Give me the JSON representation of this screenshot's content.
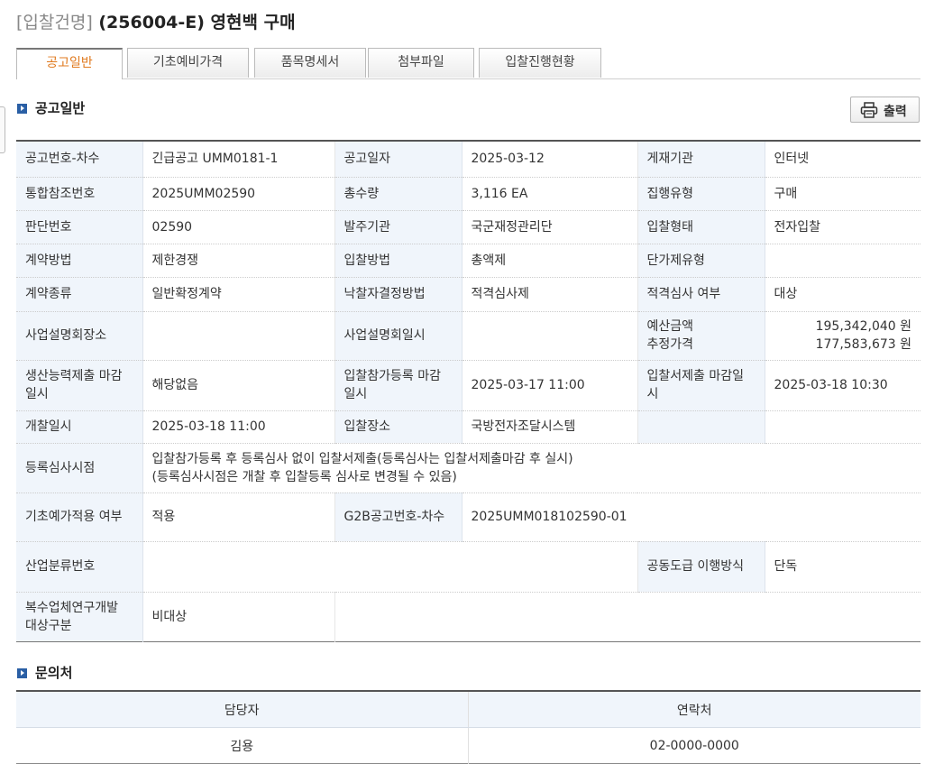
{
  "title": {
    "prefix": "[입찰건명]",
    "main": "(256004-E) 영현백 구매"
  },
  "tabs": [
    "공고일반",
    "기초예비가격",
    "품목명세서",
    "첨부파일",
    "입찰진행현황"
  ],
  "section_general": "공고일반",
  "print_label": "출력",
  "info": {
    "r1": {
      "l1": "공고번호-차수",
      "v1": "긴급공고 UMM0181-1",
      "l2": "공고일자",
      "v2": "2025-03-12",
      "l3": "게재기관",
      "v3": "인터넷"
    },
    "r2": {
      "l1": "통합참조번호",
      "v1": "2025UMM02590",
      "l2": "총수량",
      "v2": "3,116 EA",
      "l3": "집행유형",
      "v3": "구매"
    },
    "r3": {
      "l1": "판단번호",
      "v1": "02590",
      "l2": "발주기관",
      "v2": "국군재정관리단",
      "l3": "입찰형태",
      "v3": "전자입찰"
    },
    "r4": {
      "l1": "계약방법",
      "v1": "제한경쟁",
      "l2": "입찰방법",
      "v2": "총액제",
      "l3": "단가제유형",
      "v3": ""
    },
    "r5": {
      "l1": "계약종류",
      "v1": "일반확정계약",
      "l2": "낙찰자결정방법",
      "v2": "적격심사제",
      "l3": "적격심사 여부",
      "v3": "대상"
    },
    "r6": {
      "l1": "사업설명회장소",
      "v1": "",
      "l2": "사업설명회일시",
      "v2": "",
      "l3a": "예산금액",
      "l3b": "추정가격",
      "v3a": "195,342,040 원",
      "v3b": "177,583,673 원"
    },
    "r7": {
      "l1": "생산능력제출 마감일시",
      "v1": "해당없음",
      "l2": "입찰참가등록 마감일시",
      "v2": "2025-03-17 11:00",
      "l3": "입찰서제출 마감일시",
      "v3": "2025-03-18 10:30"
    },
    "r8": {
      "l1": "개찰일시",
      "v1": "2025-03-18 11:00",
      "l2": "입찰장소",
      "v2": "국방전자조달시스템",
      "l3": "",
      "v3": ""
    },
    "r9": {
      "l1": "등록심사시점",
      "v1a": "입찰참가등록 후 등록심사 없이 입찰서제출(등록심사는 입찰서제출마감 후 실시)",
      "v1b": "(등록심사시점은 개찰 후 입찰등록 심사로 변경될 수 있음)"
    },
    "r10": {
      "l1": "기초예가적용 여부",
      "v1": "적용",
      "l2": "G2B공고번호-차수",
      "v2": "2025UMM018102590-01"
    },
    "r11": {
      "l1": "산업분류번호",
      "v1": "",
      "l3": "공동도급 이행방식",
      "v3": "단독"
    },
    "r12": {
      "l1": "복수업체연구개발 대상구분",
      "v1": "비대상"
    }
  },
  "section_contact": "문의처",
  "contact": {
    "headers": [
      "담당자",
      "연락처"
    ],
    "rows": [
      [
        "김용",
        "02-0000-0000"
      ]
    ]
  }
}
